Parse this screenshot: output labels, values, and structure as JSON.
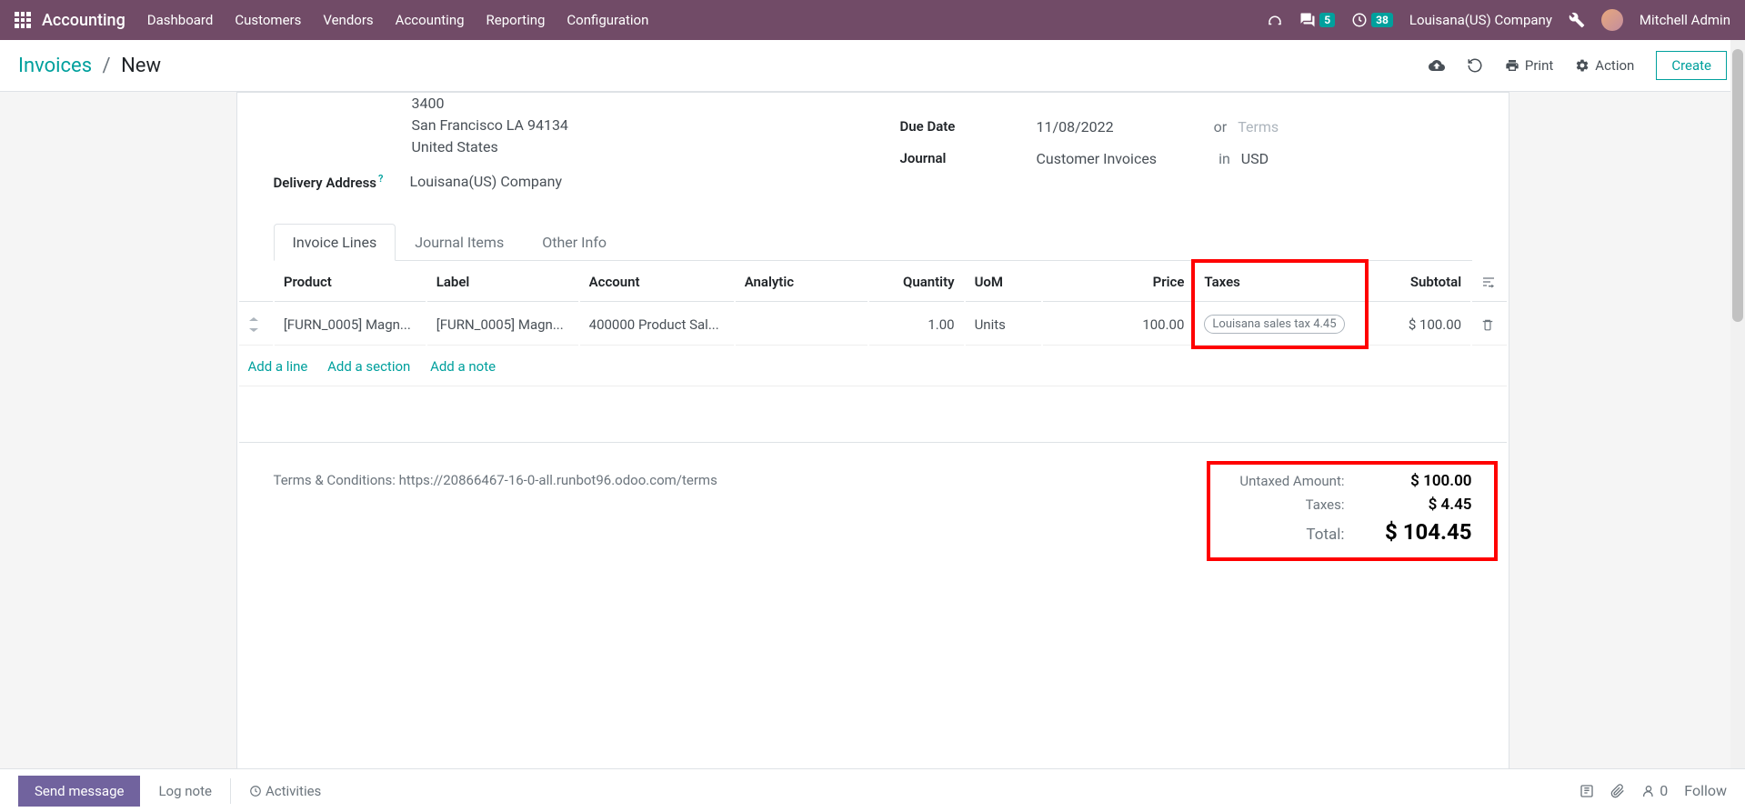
{
  "topbar": {
    "app_name": "Accounting",
    "nav": [
      "Dashboard",
      "Customers",
      "Vendors",
      "Accounting",
      "Reporting",
      "Configuration"
    ],
    "msg_count": "5",
    "activity_count": "38",
    "company": "Louisana(US) Company",
    "user": "Mitchell Admin"
  },
  "breadcrumb": {
    "parent": "Invoices",
    "current": "New"
  },
  "toolbar": {
    "print": "Print",
    "action": "Action",
    "create": "Create"
  },
  "form": {
    "address_line1": "3400",
    "address_line2": "San Francisco LA 94134",
    "address_line3": "United States",
    "delivery_label": "Delivery Address",
    "delivery_value": "Louisana(US) Company",
    "due_label": "Due Date",
    "due_value": "11/08/2022",
    "or": "or",
    "terms_placeholder": "Terms",
    "journal_label": "Journal",
    "journal_value": "Customer Invoices",
    "in": "in",
    "currency": "USD"
  },
  "tabs": {
    "t1": "Invoice Lines",
    "t2": "Journal Items",
    "t3": "Other Info"
  },
  "table": {
    "headers": {
      "product": "Product",
      "label": "Label",
      "account": "Account",
      "analytic": "Analytic",
      "quantity": "Quantity",
      "uom": "UoM",
      "price": "Price",
      "taxes": "Taxes",
      "subtotal": "Subtotal"
    },
    "row": {
      "product": "[FURN_0005] Magn...",
      "label": "[FURN_0005] Magn...",
      "account": "400000 Product Sal...",
      "analytic": "",
      "quantity": "1.00",
      "uom": "Units",
      "price": "100.00",
      "taxes": "Louisana sales tax 4.45",
      "subtotal": "$ 100.00"
    },
    "actions": {
      "add_line": "Add a line",
      "add_section": "Add a section",
      "add_note": "Add a note"
    }
  },
  "footer": {
    "terms": "Terms & Conditions: https://20866467-16-0-all.runbot96.odoo.com/terms",
    "untaxed_label": "Untaxed Amount:",
    "untaxed_value": "$ 100.00",
    "taxes_label": "Taxes:",
    "taxes_value": "$ 4.45",
    "total_label": "Total:",
    "total_value": "$ 104.45"
  },
  "chatter": {
    "send": "Send message",
    "log": "Log note",
    "activities": "Activities",
    "followers": "0",
    "follow": "Follow"
  }
}
